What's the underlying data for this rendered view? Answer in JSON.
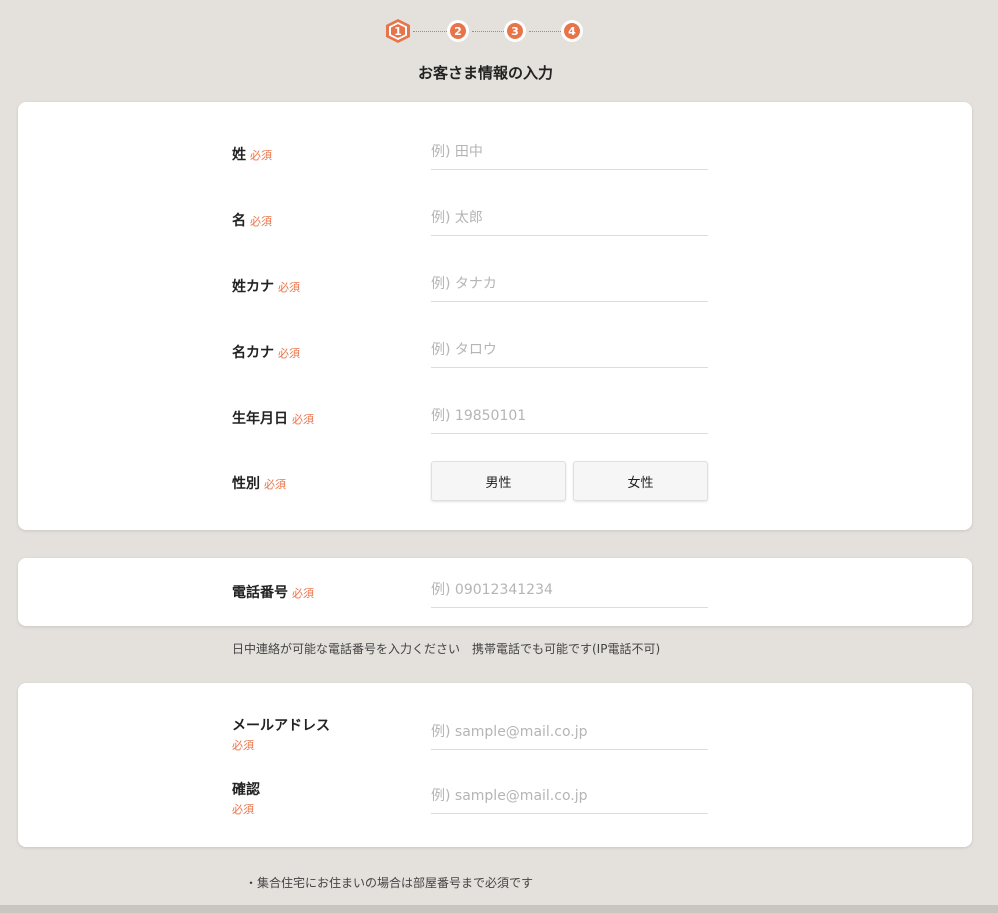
{
  "stepper": {
    "steps": [
      "1",
      "2",
      "3",
      "4"
    ],
    "active": 1,
    "accent": "#e8744a"
  },
  "page": {
    "title": "お客さま情報の入力"
  },
  "form": {
    "required_label": "必須",
    "last_name": {
      "label": "姓",
      "placeholder": "例) 田中"
    },
    "first_name": {
      "label": "名",
      "placeholder": "例) 太郎"
    },
    "last_name_kana": {
      "label": "姓カナ",
      "placeholder": "例) タナカ"
    },
    "first_name_kana": {
      "label": "名カナ",
      "placeholder": "例) タロウ"
    },
    "birthdate": {
      "label": "生年月日",
      "placeholder": "例) 19850101"
    },
    "gender": {
      "label": "性別",
      "options": [
        "男性",
        "女性"
      ]
    },
    "phone": {
      "label": "電話番号",
      "placeholder": "例) 09012341234",
      "note": "日中連絡が可能な電話番号を入力ください　携帯電話でも可能です(IP電話不可)"
    },
    "email": {
      "label": "メールアドレス",
      "placeholder": "例) sample@mail.co.jp"
    },
    "email_confirm": {
      "label": "確認",
      "placeholder": "例) sample@mail.co.jp"
    },
    "address_note": "・集合住宅にお住まいの場合は部屋番号まで必須です"
  }
}
